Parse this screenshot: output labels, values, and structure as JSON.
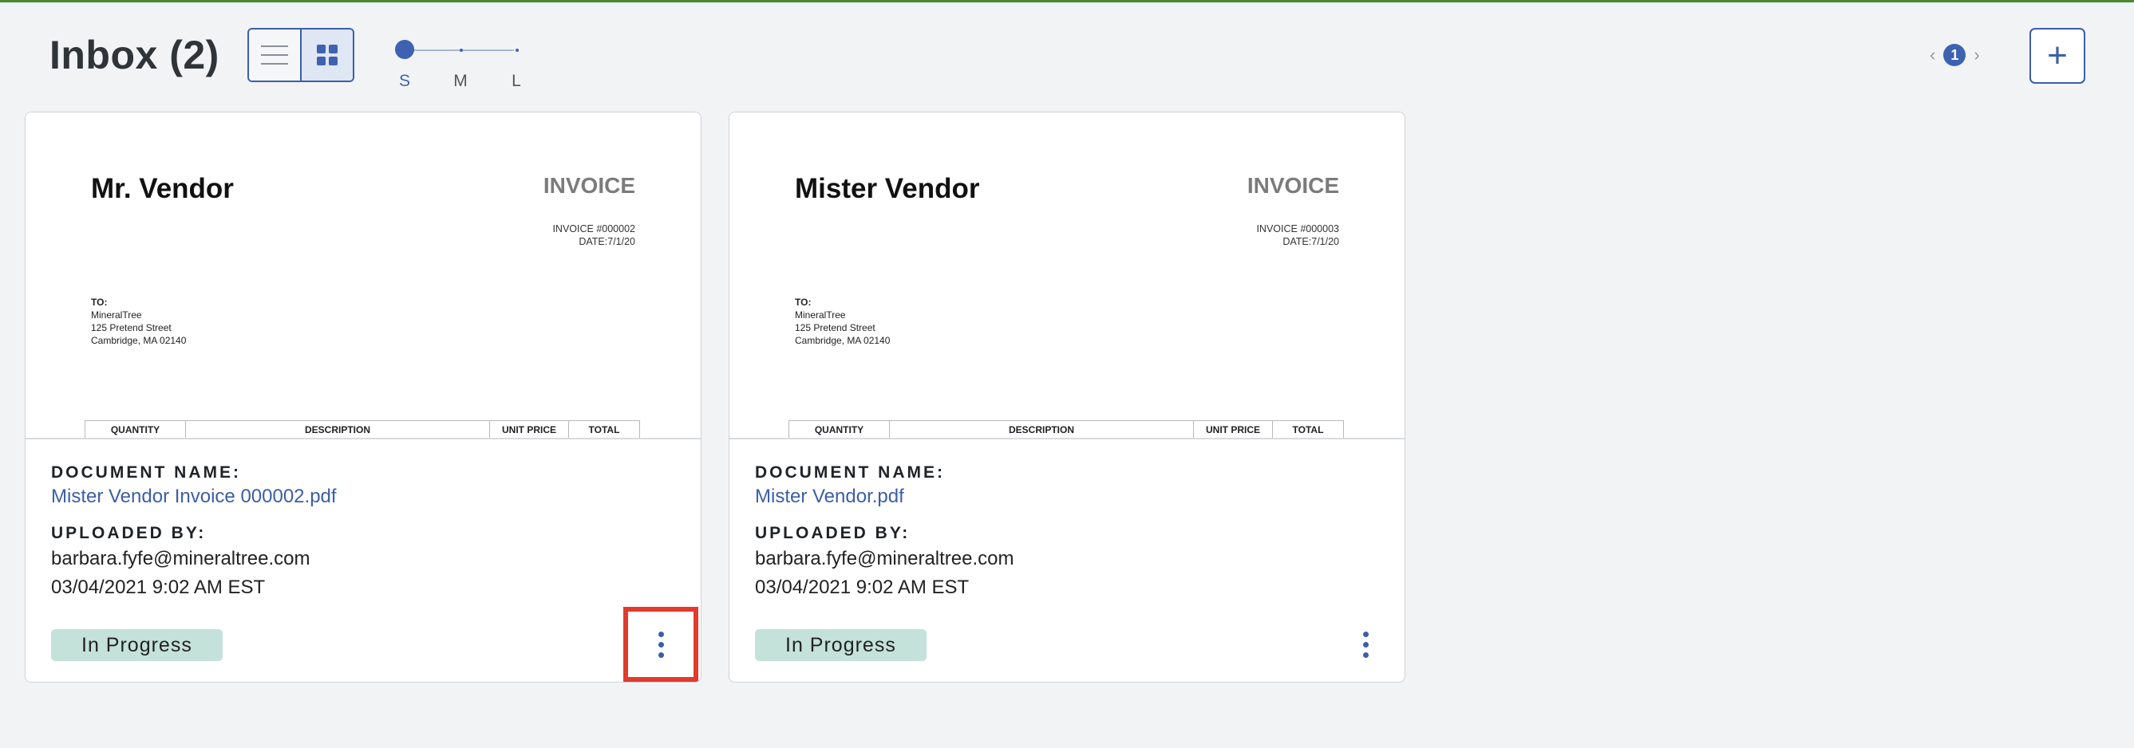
{
  "header": {
    "title": "Inbox (2)",
    "size_labels": [
      "S",
      "M",
      "L"
    ],
    "selected_size": "S",
    "view_mode": "grid",
    "page": "1",
    "prev_glyph": "‹",
    "next_glyph": "›",
    "add_glyph": "+"
  },
  "cards": [
    {
      "preview": {
        "vendor": "Mr. Vendor",
        "invoice_title": "INVOICE",
        "invoice_number": "INVOICE #000002",
        "invoice_date": "DATE:7/1/20",
        "to_label": "TO:",
        "to_lines": [
          "MineralTree",
          "125 Pretend Street",
          "Cambridge, MA 02140"
        ],
        "columns": [
          "QUANTITY",
          "DESCRIPTION",
          "UNIT PRICE",
          "TOTAL"
        ]
      },
      "doc_label": "DOCUMENT NAME:",
      "doc_name": "Mister Vendor Invoice 000002.pdf",
      "uploaded_label": "UPLOADED BY:",
      "uploader": "barbara.fyfe@mineraltree.com",
      "uploaded_at": "03/04/2021 9:02 AM EST",
      "status": "In Progress"
    },
    {
      "preview": {
        "vendor": "Mister Vendor",
        "invoice_title": "INVOICE",
        "invoice_number": "INVOICE #000003",
        "invoice_date": "DATE:7/1/20",
        "to_label": "TO:",
        "to_lines": [
          "MineralTree",
          "125 Pretend Street",
          "Cambridge, MA 02140"
        ],
        "columns": [
          "QUANTITY",
          "DESCRIPTION",
          "UNIT PRICE",
          "TOTAL"
        ]
      },
      "doc_label": "DOCUMENT NAME:",
      "doc_name": "Mister Vendor.pdf",
      "uploaded_label": "UPLOADED BY:",
      "uploader": "barbara.fyfe@mineraltree.com",
      "uploaded_at": "03/04/2021 9:02 AM EST",
      "status": "In Progress"
    }
  ],
  "colors": {
    "accent": "#3b5ea8",
    "status_bg": "#c4e1da",
    "highlight": "#e23a2b",
    "top_bar": "#4a8a2c"
  },
  "icons": {
    "list_view": "list-view-icon",
    "grid_view": "grid-view-icon",
    "more": "more-vertical-icon"
  }
}
